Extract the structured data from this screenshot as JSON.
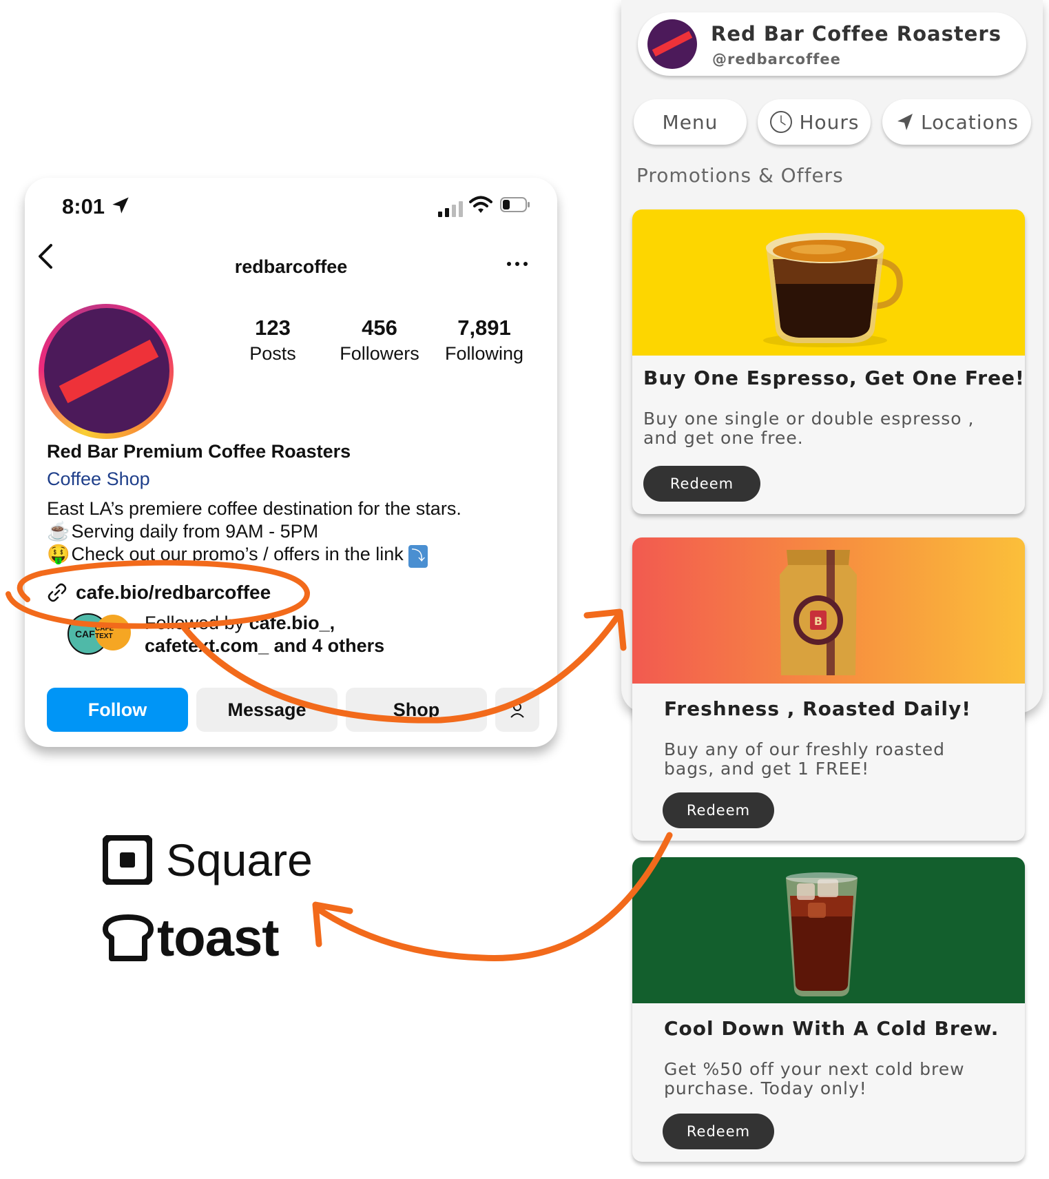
{
  "instagram": {
    "status_time": "8:01",
    "username": "redbarcoffee",
    "stats": [
      {
        "value": "123",
        "label": "Posts"
      },
      {
        "value": "456",
        "label": "Followers"
      },
      {
        "value": "7,891",
        "label": "Following"
      }
    ],
    "profile_name": "Red Bar Premium Coffee Roasters",
    "category": "Coffee Shop",
    "bio_lines": [
      "East LA’s premiere coffee destination for the stars.",
      "Serving daily from 9AM - 5PM",
      "Check out our promo’s / offers in the link"
    ],
    "bio_emojis": [
      "☕",
      "🤑",
      "⤵"
    ],
    "link": "cafe.bio/redbarcoffee",
    "followed_by_prefix": "Followed by ",
    "followed_by_line1": "cafe.bio_,",
    "followed_by_line2": "cafetext.com_ and 4 others",
    "follower_avatar_a": "CAFE",
    "follower_avatar_b": "CAFE TEXT",
    "buttons": {
      "follow": "Follow",
      "message": "Message",
      "shop": "Shop"
    },
    "follow_color": "#0095f6"
  },
  "bio_page": {
    "title": "Red Bar Coffee Roasters",
    "handle": "@redbarcoffee",
    "nav": {
      "menu": "Menu",
      "hours": "Hours",
      "locations": "Locations"
    },
    "section_title": "Promotions & Offers",
    "promos": [
      {
        "title": "Buy One Espresso, Get One Free!",
        "description": "Buy one single or double espresso , and get one free.",
        "button": "Redeem",
        "banner_color": "#fdd600"
      },
      {
        "title": "Freshness , Roasted Daily!",
        "description": "Buy any of our freshly roasted bags, and get 1 FREE!",
        "button": "Redeem",
        "banner_color": "#f46a4e"
      },
      {
        "title": "Cool Down With A Cold Brew.",
        "description": "Get %50 off your next cold brew purchase. Today only!",
        "button": "Redeem",
        "banner_color": "#135f2d"
      }
    ]
  },
  "pos": {
    "square": "Square",
    "toast": "toast"
  },
  "brand_colors": {
    "purple": "#4c1a5a",
    "red": "#ee3239",
    "arrow_orange": "#f26a1b"
  }
}
